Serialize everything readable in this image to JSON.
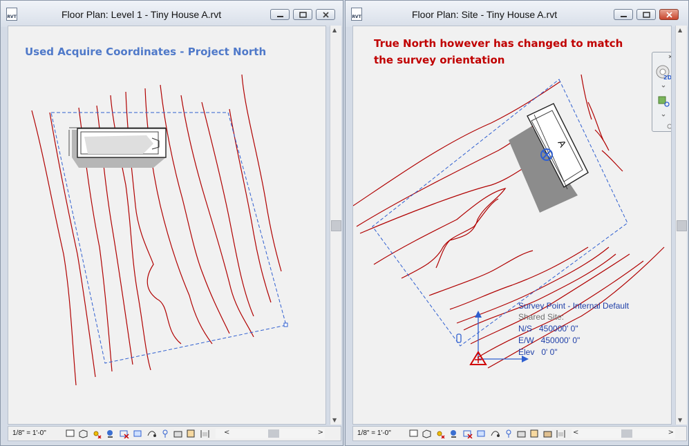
{
  "left_window": {
    "title": "Floor Plan: Level 1 - Tiny House A.rvt",
    "app_icon_label": "RVT",
    "annotation": "Used Acquire Coordinates - Project North",
    "scale": "1/8\" = 1'-0\""
  },
  "right_window": {
    "title": "Floor Plan: Site - Tiny House A.rvt",
    "app_icon_label": "RVT",
    "annotation_line1": "True North however has changed to match",
    "annotation_line2": "the survey orientation",
    "scale": "1/8\" = 1'-0\"",
    "nav_label_2d": "2D",
    "building_tag": "A",
    "survey_point": {
      "title": "Survey Point - Internal Default",
      "shared_site": "Shared Site:",
      "ns": "N/S   450000' 0\"",
      "ew": "E/W   450000' 0\"",
      "elev": "Elev   0' 0\""
    }
  },
  "colors": {
    "contour": "#b00000",
    "crop_region": "#2f5fd0",
    "left_note": "#4f79c9",
    "right_note": "#c00000",
    "survey_text": "#1f3fa8",
    "shared_site_text": "#707070"
  },
  "status_icons": [
    "detail-level-icon",
    "visual-style-icon",
    "sun-path-icon",
    "shadows-icon",
    "crop-view-icon",
    "show-crop-icon",
    "unlock-3d-icon",
    "temporary-hide-icon",
    "reveal-hidden-icon",
    "worksharing-icon",
    "design-options-icon",
    "analytical-model-icon"
  ]
}
